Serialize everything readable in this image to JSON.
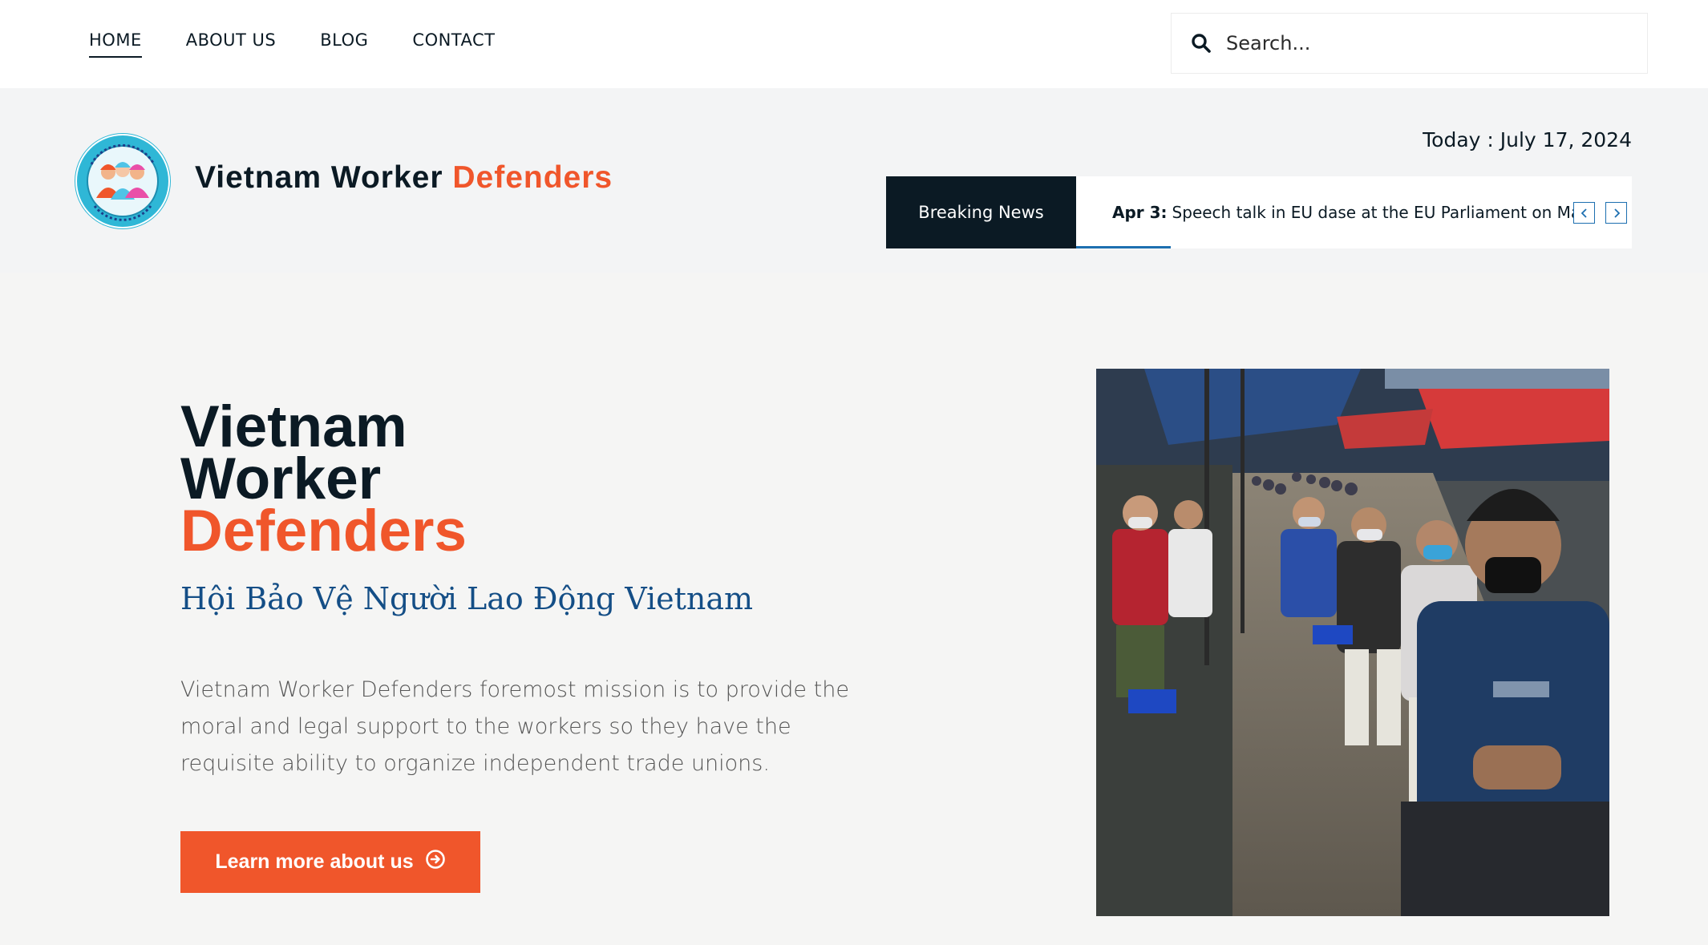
{
  "nav": {
    "items": [
      {
        "label": "HOME",
        "active": true
      },
      {
        "label": "ABOUT US",
        "active": false
      },
      {
        "label": "BLOG",
        "active": false
      },
      {
        "label": "CONTACT",
        "active": false
      }
    ]
  },
  "search": {
    "placeholder": "Search...",
    "icon": "search-icon"
  },
  "brand": {
    "name_part1": "Vietnam Worker",
    "name_part2": "Defenders",
    "logo_icon": "organization-logo"
  },
  "header": {
    "today": "Today : July 17, 2024"
  },
  "ticker": {
    "label": "Breaking News",
    "date": "Apr 3:",
    "text": "Speech talk in EU dase at the EU Parliament on Ma",
    "prev_icon": "chevron-left-icon",
    "next_icon": "chevron-right-icon",
    "progress": 0.17
  },
  "hero": {
    "title_line1": "Vietnam",
    "title_line2": "Worker",
    "title_line3": "Defenders",
    "subtitle": "Hội Bảo Vệ Người Lao Động Vietnam",
    "description": "Vietnam Worker Defenders foremost mission is to provide the moral and legal support to the workers so they have the requisite ability to organize independent trade unions.",
    "cta_label": "Learn more about us",
    "cta_icon": "arrow-right-circle-icon"
  },
  "colors": {
    "accent": "#f0562b",
    "dark": "#0b1a24",
    "subtitle_blue": "#144e86",
    "ticker_blue": "#1d6fb0"
  }
}
